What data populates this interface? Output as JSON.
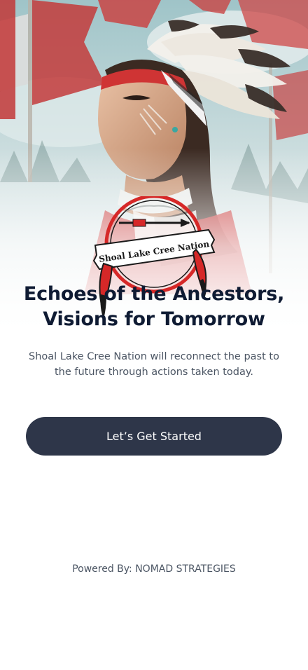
{
  "hero": {
    "logo": {
      "text": "Shoal Lake Cree Nation",
      "icon": "feathered-dreamcatcher-emblem"
    }
  },
  "content": {
    "headline_line1": "Echoes of the Ancestors,",
    "headline_line2": "Visions for Tomorrow",
    "subtitle": "Shoal Lake Cree Nation will reconnect the past to the future through actions taken today."
  },
  "cta": {
    "label": "Let’s Get Started"
  },
  "footer": {
    "text": "Powered By: NOMAD STRATEGIES"
  },
  "colors": {
    "primary_button": "#2e3649",
    "headline": "#0f1b33",
    "body_text": "#4b5563",
    "emblem_red": "#d62828"
  }
}
